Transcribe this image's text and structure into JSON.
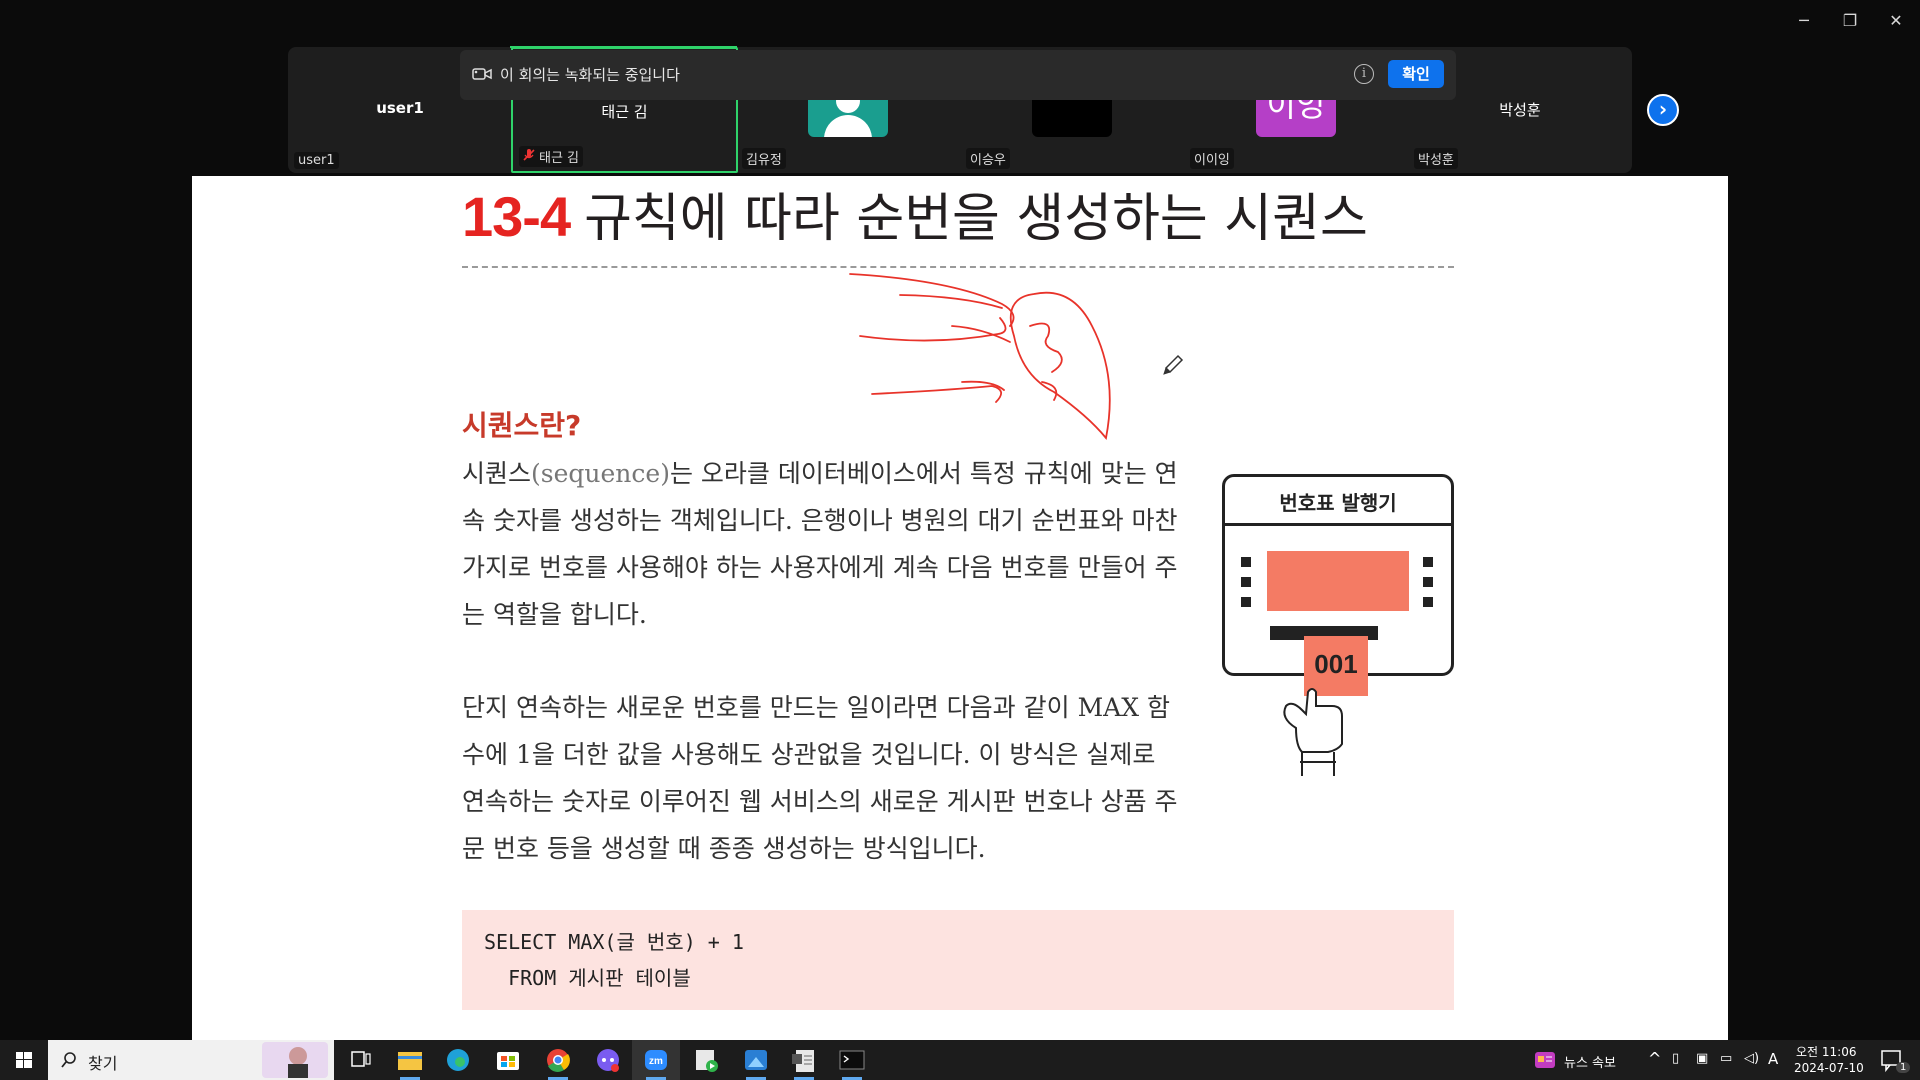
{
  "window_controls": {
    "minimize": "─",
    "restore": "❐",
    "close": "✕"
  },
  "participants": [
    {
      "center": "user1",
      "label": "user1"
    },
    {
      "center": "태근 김",
      "label": "태근 김",
      "muted": true
    },
    {
      "center": "",
      "label": "김유정"
    },
    {
      "center": "",
      "label": "이승우"
    },
    {
      "center": "",
      "label": "이이잉",
      "avatar_text": "이잉"
    },
    {
      "center": "박성훈",
      "label": "박성훈"
    }
  ],
  "banner": {
    "text": "이 회의는 녹화되는 중입니다",
    "info_symbol": "i",
    "ok_label": "확인"
  },
  "next_symbol": "›",
  "doc": {
    "section_number": "13-4",
    "section_title": "규칙에 따라 순번을 생성하는 시퀀스",
    "heading": "시퀀스란?",
    "para1_a": "시퀀스",
    "para1_eng": "(sequence)",
    "para1_b": "는 오라클 데이터베이스에서 특정 규칙에 맞는 연속 숫자를 생성하는 객체입니다. 은행이나 병원의 대기 순번표와 마찬가지로 번호를 사용해야 하는 사용자에게 계속 다음 번호를 만들어 주는 역할을 합니다.",
    "para2": "단지 연속하는 새로운 번호를 만드는 일이라면 다음과 같이 MAX 함수에 1을 더한 값을 사용해도 상관없을 것입니다. 이 방식은 실제로 연속하는 숫자로 이루어진 웹 서비스의 새로운 게시판 번호나 상품 주문 번호 등을 생성할 때 종종 생성하는 방식입니다.",
    "code_line1": "SELECT MAX(글 번호) + 1",
    "code_line2": "  FROM 게시판 테이블",
    "illustration_title": "번호표 발행기",
    "ticket_number": "001"
  },
  "taskbar": {
    "search_label": "찾기",
    "news_label": "뉴스 속보",
    "ime_label": "A",
    "time": "오전 11:06",
    "date": "2024-07-10",
    "notification_count": "1"
  },
  "colors": {
    "accent_blue": "#0e72ed",
    "active_speaker": "#2fd36a",
    "title_red": "#e52421",
    "heading_red": "#c73a2a",
    "code_bg": "#fde3e0",
    "annotation": "#e8332a"
  }
}
